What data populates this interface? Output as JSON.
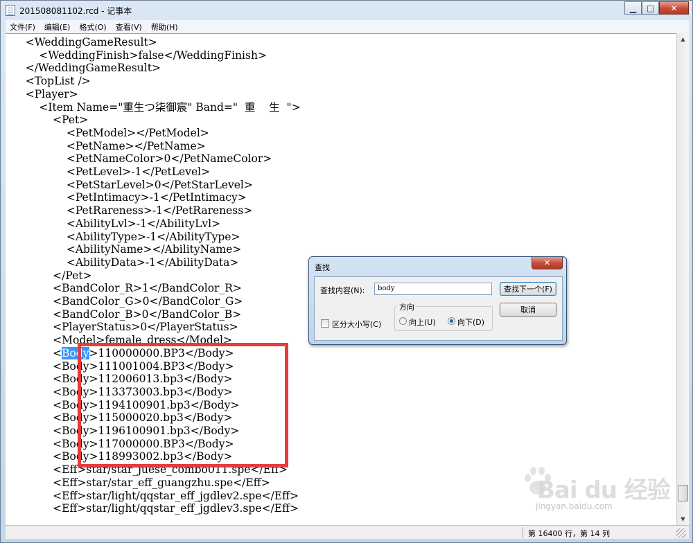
{
  "window": {
    "title": "201508081102.rcd - 记事本",
    "minimize_glyph": "▁",
    "maximize_glyph": "□",
    "close_glyph": "✕"
  },
  "menu": [
    "文件(F)",
    "编辑(E)",
    "格式(O)",
    "查看(V)",
    "帮助(H)"
  ],
  "editor": {
    "lines": [
      "    <WeddingGameResult>",
      "        <WeddingFinish>false</WeddingFinish>",
      "    </WeddingGameResult>",
      "    <TopList />",
      "    <Player>",
      "        <Item Name=\"重生つ柒御宸\" Band=\"  重    生  \">",
      "            <Pet>",
      "                <PetModel></PetModel>",
      "                <PetName></PetName>",
      "                <PetNameColor>0</PetNameColor>",
      "                <PetLevel>-1</PetLevel>",
      "                <PetStarLevel>0</PetStarLevel>",
      "                <PetIntimacy>-1</PetIntimacy>",
      "                <PetRareness>-1</PetRareness>",
      "                <AbilityLvl>-1</AbilityLvl>",
      "                <AbilityType>-1</AbilityType>",
      "                <AbilityName></AbilityName>",
      "                <AbilityData>-1</AbilityData>",
      "            </Pet>",
      "            <BandColor_R>1</BandColor_R>",
      "            <BandColor_G>0</BandColor_G>",
      "            <BandColor_B>0</BandColor_B>",
      "            <PlayerStatus>0</PlayerStatus>",
      "            <Model>female_dress</Model>",
      "            <Body>110000000.BP3</Body>",
      "            <Body>111001004.BP3</Body>",
      "            <Body>112006013.bp3</Body>",
      "            <Body>113373003.bp3</Body>",
      "            <Body>1194100901.bp3</Body>",
      "            <Body>115000020.bp3</Body>",
      "            <Body>1196100901.bp3</Body>",
      "            <Body>117000000.BP3</Body>",
      "            <Body>118993002.bp3</Body>",
      "            <Eff>star/star_juese_combo011.spe</Eff>",
      "            <Eff>star/star_eff_guangzhu.spe</Eff>",
      "            <Eff>star/light/qqstar_eff_jgdlev2.spe</Eff>",
      "            <Eff>star/light/qqstar_eff_jgdlev3.spe</Eff>"
    ],
    "selected_line_index": 24,
    "selection_prefix": "            <",
    "selection_text": "Body",
    "selection_suffix": ">110000000.BP3</Body>"
  },
  "find_dialog": {
    "title": "查找",
    "close_glyph": "✕",
    "find_label": "查找内容(N):",
    "find_value": "body",
    "find_next_button": "查找下一个(F)",
    "cancel_button": "取消",
    "direction_label": "方向",
    "direction_up": "向上(U)",
    "direction_down": "向下(D)",
    "direction_selected": "down",
    "match_case_label": "区分大小写(C)",
    "match_case_checked": false
  },
  "status_bar": {
    "position": "第 16400 行，第 14 列"
  },
  "watermark": {
    "brand": "Bai du 经验",
    "url": "jingyan.baidu.com"
  },
  "colors": {
    "selection": "#3399ff",
    "highlight_box": "#e53c3c"
  }
}
